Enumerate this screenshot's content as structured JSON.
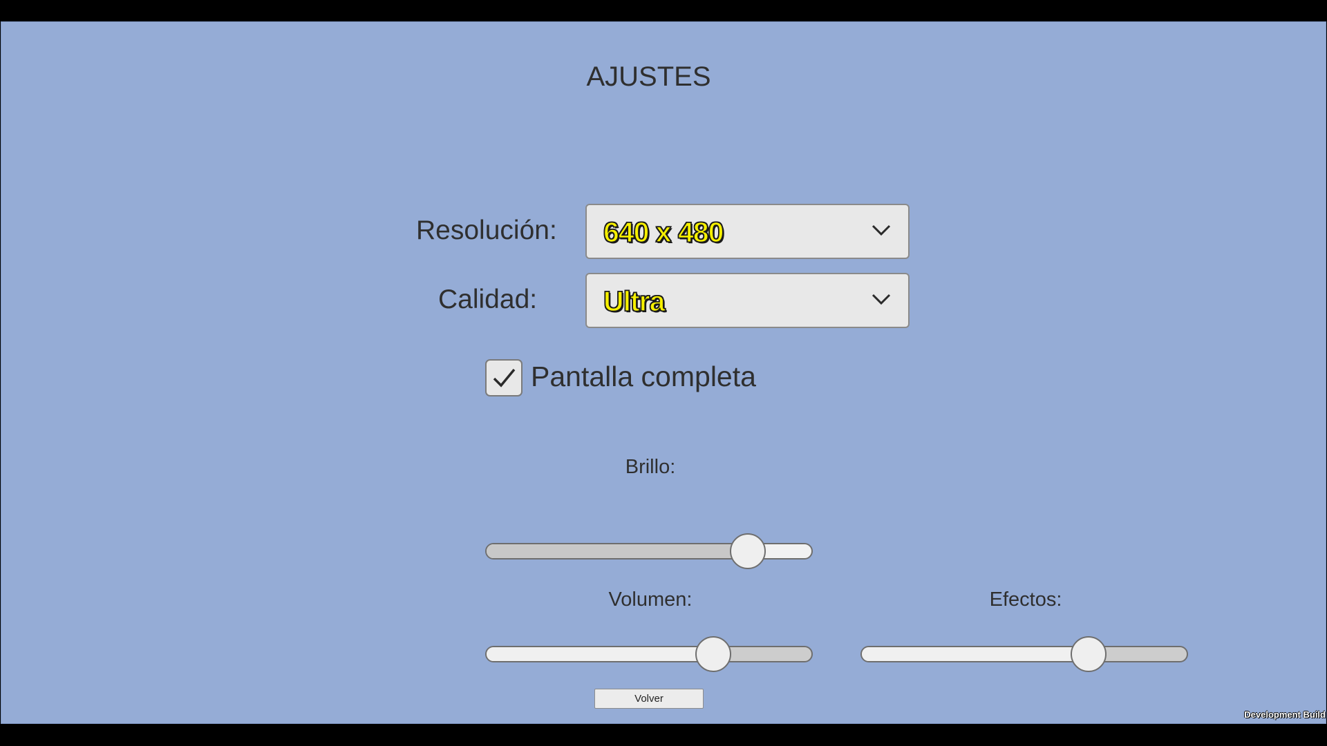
{
  "title": "AJUSTES",
  "resolution": {
    "label": "Resolución:",
    "value": "640 x 480"
  },
  "quality": {
    "label": "Calidad:",
    "value": "Ultra"
  },
  "fullscreen": {
    "label": "Pantalla completa",
    "checked": true
  },
  "brightness": {
    "label": "Brillo:",
    "level": 0.84
  },
  "volume": {
    "label": "Volumen:",
    "level": 0.72
  },
  "effects": {
    "label": "Efectos:",
    "level": 0.72
  },
  "back_button": {
    "label": "Volver"
  },
  "watermark": "Development Build",
  "colors": {
    "background": "#95acd6",
    "dropdown_text": "#f6f000"
  }
}
